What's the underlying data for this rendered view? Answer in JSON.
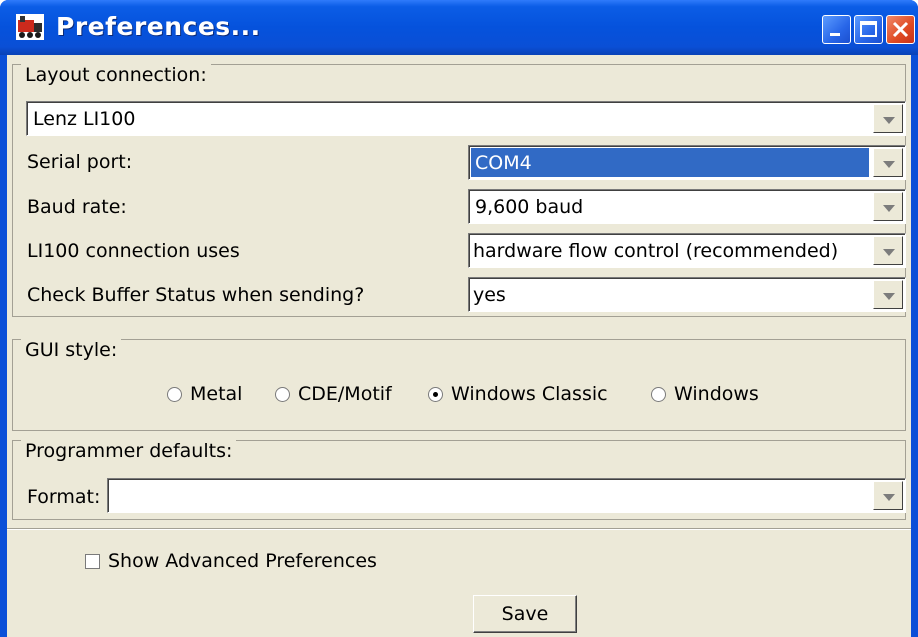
{
  "window": {
    "title": "Preferences...",
    "icon": "train-app-icon",
    "controls": [
      "minimize",
      "maximize",
      "close"
    ]
  },
  "layout_connection": {
    "legend": "Layout connection:",
    "system": "Lenz LI100",
    "serial_port_label": "Serial port:",
    "serial_port_value": "COM4",
    "baud_rate_label": "Baud rate:",
    "baud_rate_value": "9,600 baud",
    "connection_uses_label": "LI100 connection uses",
    "connection_uses_value": "hardware flow control (recommended)",
    "check_buffer_label": "Check Buffer Status when sending?",
    "check_buffer_value": "yes"
  },
  "gui_style": {
    "legend": "GUI style:",
    "options": [
      "Metal",
      "CDE/Motif",
      "Windows Classic",
      "Windows"
    ],
    "selected": "Windows Classic"
  },
  "programmer_defaults": {
    "legend": "Programmer defaults:",
    "format_label": "Format:",
    "format_value": ""
  },
  "advanced": {
    "label": "Show Advanced Preferences",
    "checked": false
  },
  "save_label": "Save",
  "colors": {
    "titlebar": "#0552dc",
    "dialog_bg": "#ece9d8",
    "selection": "#316ac5",
    "close_button": "#df4a22"
  }
}
